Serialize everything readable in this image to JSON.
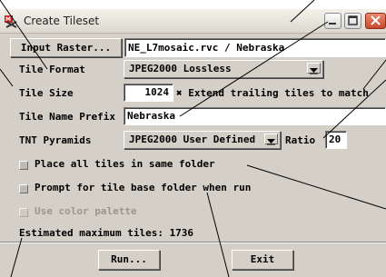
{
  "window": {
    "title": "Create Tileset"
  },
  "titlebar_buttons": {
    "minimize": "minimize-icon",
    "maximize": "maximize-icon",
    "close": "close-icon"
  },
  "input_raster": {
    "button_label": "Input Raster...",
    "value": "NE_L7mosaic.rvc / Nebraska"
  },
  "tile_format": {
    "label": "Tile Format",
    "value": "JPEG2000 Lossless"
  },
  "tile_size": {
    "label": "Tile Size",
    "value": "1024",
    "extend_label": "Extend trailing tiles to match",
    "extend_checked": true
  },
  "tile_name_prefix": {
    "label": "Tile Name Prefix",
    "value": "Nebraska"
  },
  "tnt_pyramids": {
    "label": "TNT Pyramids",
    "value": "JPEG2000 User Defined",
    "ratio_label": "Ratio",
    "ratio_value": "20"
  },
  "options": {
    "same_folder": {
      "label": "Place all tiles in same folder",
      "checked": false
    },
    "prompt_folder": {
      "label": "Prompt for tile base folder when run",
      "checked": false
    },
    "color_palette": {
      "label": "Use color palette",
      "checked": false,
      "enabled": false
    }
  },
  "estimate": {
    "text": "Estimated maximum tiles: 1736"
  },
  "buttons": {
    "run": "Run...",
    "exit": "Exit"
  },
  "colors": {
    "dialog_bg": "#d4d0c8",
    "close_button": "#c84a2d",
    "field_bg": "#ffffff"
  }
}
